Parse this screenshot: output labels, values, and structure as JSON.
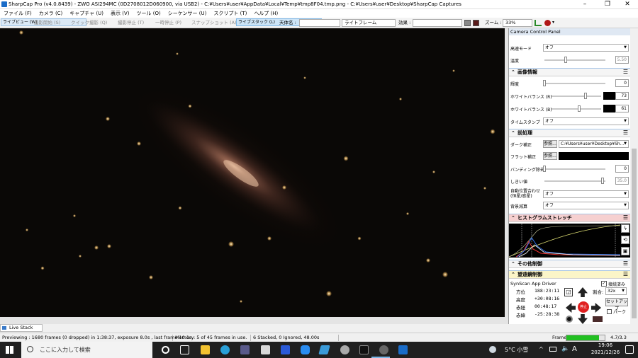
{
  "window": {
    "title": "SharpCap Pro (v4.0.8439) - ZWO ASI294MC (0D2708012D060900, via USB2) - C:¥Users¥user¥AppData¥Local¥Temp¥tmp8F04.tmp.png - C:¥Users¥user¥Desktop¥SharpCap Captures"
  },
  "menu": [
    "ファイル (F)",
    "カメラ (C)",
    "キャプチャ (U)",
    "表示 (V)",
    "ツール (O)",
    "シーケンサー (U)",
    "スクリプト (T)",
    "ヘルプ (H)"
  ],
  "toolbar": {
    "live_view": "ライブビュー (W)",
    "start_capture": "撮影開始 (S)",
    "quick_capture": "クイック撮影 (Q)",
    "stop_capture": "撮影停止 (T)",
    "pause": "一時停止 (P)",
    "snapshot": "スナップショット (A)",
    "live_stack": "ライブスタック (L)",
    "object_name_label": "天体名 :",
    "reticle_value": "ライトフレーム",
    "effect_label": "効果 :",
    "zoom_label": "ズーム :",
    "zoom_value": "33%"
  },
  "panel": {
    "title": "Camera Control Panel",
    "high_speed_label": "高速モード",
    "high_speed_value": "オフ",
    "temp_label": "温度",
    "temp_value": "5.50",
    "image_section": "画像情報",
    "gamma_label": "輝度",
    "gamma_value": "0",
    "wb_r_label": "ホワイトバランス (R)",
    "wb_r_value": "73",
    "wb_b_label": "ホワイトバランス (B)",
    "wb_b_value": "61",
    "timestamp_label": "タイムスタンプ",
    "timestamp_value": "オフ",
    "pre_section": "前処理",
    "dark_label": "ダーク補正",
    "dark_browse": "参照...",
    "dark_path": "C:¥Users¥user¥Desktop¥Sh...",
    "flat_label": "フラット補正",
    "flat_browse": "参照...",
    "banding_label": "バンディング除去",
    "banding_value": "0",
    "threshold_label": "しきい値",
    "threshold_value": "35.0",
    "autoalign_label": "自動位置合わせ (恒星/惑星)",
    "autoalign_value": "オフ",
    "bg_label": "背景減算",
    "bg_value": "オフ",
    "histo_section": "ヒストグラムストレッチ",
    "other_section": "その他制御",
    "scope_section": "望遠鏡制御",
    "scope_driver": "SynScan App Driver",
    "connected_label": "接続済み",
    "azimuth_label": "方位",
    "azimuth_value": "188:23:11",
    "alt_label": "高度",
    "alt_value": "+30:08:16",
    "ra_label": "赤経",
    "ra_value": "00:48:17",
    "dec_label": "赤緯",
    "dec_value": "-25:28:38",
    "rate_label": "割合:",
    "rate_value": "32x",
    "setup_label": "セットアップ",
    "park_label": "パーク",
    "goto_label": "停止"
  },
  "live_stack_tab": "Live Stack",
  "status": {
    "preview": "Previewing : 1680 frames (0 dropped) in 1:38:37, exposure 8.0s , last frame 10.1s",
    "memory": "Memory: 5 of 45 frames in use.",
    "stacked": "6 Stacked, 0 Ignored, 48.00s",
    "frame_label": "Frame:",
    "frame_value": "4.7/3.3",
    "frame_progress": 0.85
  },
  "taskbar": {
    "search_placeholder": "ここに入力して検索",
    "weather": "5°C 小雪",
    "ime": "A",
    "time": "19:06",
    "date": "2021/12/26"
  },
  "colors": {
    "accent": "#1a6cc8",
    "histo_header": "#f6d0d0",
    "scope_header": "#fbf5c8",
    "stop_red": "#e02020",
    "progress_green": "#22c022"
  }
}
